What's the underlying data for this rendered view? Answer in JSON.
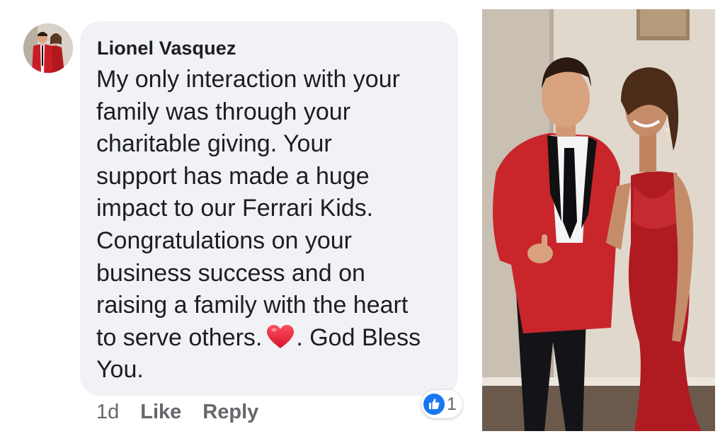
{
  "comment": {
    "author": "Lionel Vasquez",
    "lines": [
      "My only interaction with your",
      "family was through your",
      "charitable giving. Your",
      "support has made a huge",
      "impact to our Ferrari Kids.",
      "Congratulations on your",
      "business success and on",
      "raising a family with the heart"
    ],
    "line_last_before_emoji": "to serve others.",
    "line_last_after_emoji": ". God Bless",
    "line_final": "You.",
    "emoji": "red-heart-icon"
  },
  "actions": {
    "timestamp": "1d",
    "like_label": "Like",
    "reply_label": "Reply"
  },
  "reactions": {
    "icon": "like-icon",
    "count": "1",
    "color": "#1877f2"
  },
  "colors": {
    "bubble": "#f0f2f5",
    "text": "#1c1e21",
    "meta": "#65676b",
    "heart": "#e0245e"
  }
}
